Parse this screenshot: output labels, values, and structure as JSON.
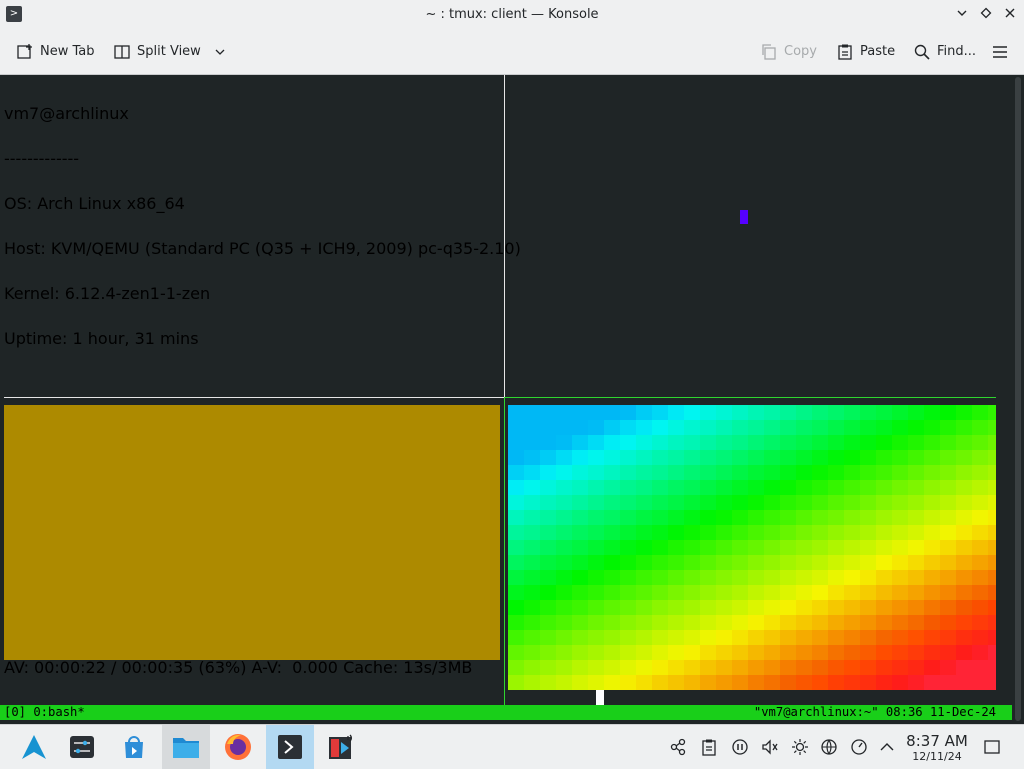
{
  "window": {
    "title": "~ : tmux: client — Konsole"
  },
  "toolbar": {
    "new_tab": "New Tab",
    "split_view": "Split View",
    "copy": "Copy",
    "paste": "Paste",
    "find": "Find..."
  },
  "pane_top_left": {
    "lines": [
      "vm7@archlinux",
      "-------------",
      "OS: Arch Linux x86_64",
      "Host: KVM/QEMU (Standard PC (Q35 + ICH9, 2009) pc-q35-2.10)",
      "Kernel: 6.12.4-zen1-1-zen",
      "Uptime: 1 hour, 31 mins"
    ]
  },
  "pane_bottom_left": {
    "video_color": "#ad8a00",
    "status": "AV: 00:00:22 / 00:00:35 (63%) A-V:  0.000 Cache: 13s/3MB"
  },
  "tmux": {
    "left": "[0] 0:bash*",
    "right": "\"vm7@archlinux:~\" 08:36 11-Dec-24"
  },
  "taskbar": {
    "apps": [
      "arch-launcher-icon",
      "system-settings-icon",
      "discover-icon",
      "file-manager-icon",
      "firefox-icon",
      "konsole-icon",
      "media-player-icon"
    ],
    "clock_time": "8:37 AM",
    "clock_date": "12/11/24"
  },
  "colors": {
    "terminal_bg": "#1f2526",
    "tmux_green": "#19cf19",
    "accent": "#3daee9"
  }
}
